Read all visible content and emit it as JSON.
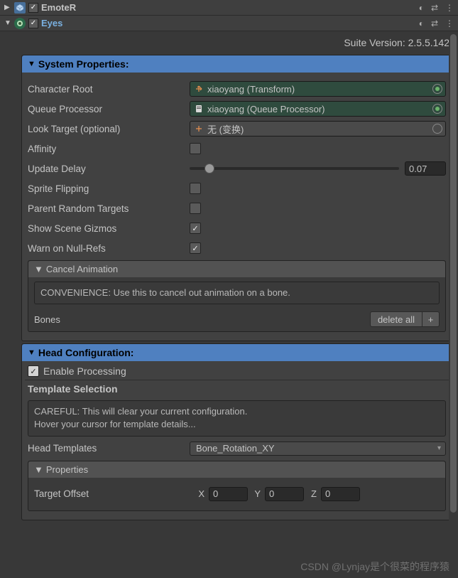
{
  "components": [
    {
      "name": "EmoteR",
      "accent": false
    },
    {
      "name": "Eyes",
      "accent": true
    }
  ],
  "suite_version": "Suite Version: 2.5.5.142",
  "system": {
    "title": "System Properties:",
    "character_root": {
      "label": "Character Root",
      "value": "xiaoyang (Transform)"
    },
    "queue_processor": {
      "label": "Queue Processor",
      "value": "xiaoyang (Queue Processor)"
    },
    "look_target": {
      "label": "Look Target (optional)",
      "value": "无 (变换)"
    },
    "affinity": {
      "label": "Affinity",
      "checked": false
    },
    "update_delay": {
      "label": "Update Delay",
      "value": "0.07",
      "pct": 7
    },
    "sprite_flipping": {
      "label": "Sprite Flipping",
      "checked": false
    },
    "parent_random_targets": {
      "label": "Parent Random Targets",
      "checked": false
    },
    "show_scene_gizmos": {
      "label": "Show Scene Gizmos",
      "checked": true
    },
    "warn_null_refs": {
      "label": "Warn on Null-Refs",
      "checked": true
    }
  },
  "cancel_anim": {
    "title": "Cancel Animation",
    "hint": "CONVENIENCE: Use this to cancel out animation on a bone.",
    "bones_label": "Bones",
    "delete_all": "delete all",
    "add": "+"
  },
  "head": {
    "title": "Head Configuration:",
    "enable_label": "Enable Processing",
    "tmpl_title": "Template Selection",
    "warn": "CAREFUL: This will clear your current configuration.\nHover your cursor for template details...",
    "tmpl_label": "Head Templates",
    "tmpl_value": "Bone_Rotation_XY"
  },
  "props": {
    "title": "Properties",
    "target_offset": {
      "label": "Target Offset",
      "x": "0",
      "y": "0",
      "z": "0"
    }
  },
  "watermark": "CSDN @Lynjay是个很菜的程序猿"
}
